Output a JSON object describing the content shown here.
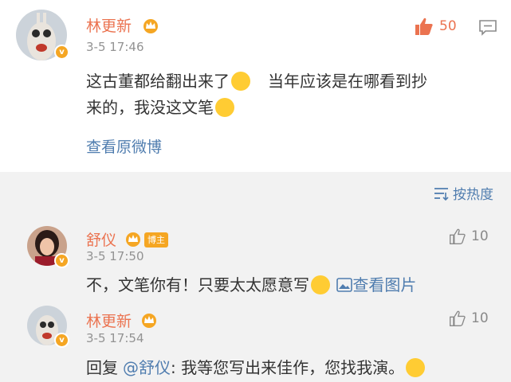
{
  "main_comment": {
    "user": "林更新",
    "time": "3-5 17:46",
    "likes": "50",
    "text_line1_a": "这古董都给翻出来了",
    "text_line1_b": "当年应该是在哪看到抄",
    "text_line2": "来的，我没这文笔",
    "view_original": "查看原微博"
  },
  "sort": {
    "label": "按热度"
  },
  "replies": [
    {
      "user": "舒仪",
      "badge": "博主",
      "time": "3-5 17:50",
      "likes": "10",
      "text": "不，文笔你有！只要太太愿意写",
      "view_image": "查看图片"
    },
    {
      "user": "林更新",
      "time": "3-5 17:54",
      "likes": "10",
      "prefix": "回复",
      "mention": "@舒仪",
      "text": ": 我等您写出来佳作，您找我演。"
    }
  ],
  "colors": {
    "name": "#eb7350",
    "link": "#507daf",
    "badge": "#f5a623"
  }
}
